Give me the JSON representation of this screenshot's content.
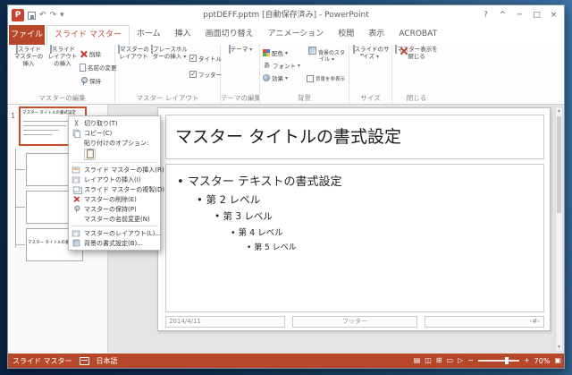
{
  "glyphs": {
    "dropdown": "▾",
    "check": "✓",
    "bullet": "•",
    "undo": "↶",
    "redo": "↷",
    "qat_arrow": "▾",
    "help": "?",
    "ribbon_options": "^",
    "minimize": "─",
    "maximize": "□",
    "close": "×",
    "app_letter": "P",
    "scroll_up": "▴",
    "scroll_down": "▾",
    "font_icon": "あ",
    "notes": "▤",
    "view_normal": "◫",
    "view_sorter": "⊞",
    "view_reading": "▭",
    "view_show": "▷",
    "zoom_out": "−",
    "zoom_in": "+",
    "fit": "▣"
  },
  "window": {
    "title": "pptDEFF.pptm [自動保存済み] - PowerPoint"
  },
  "ribbon": {
    "file_tab": "ファイル",
    "tabs": [
      {
        "label": "スライド マスター"
      },
      {
        "label": "ホーム"
      },
      {
        "label": "挿入"
      },
      {
        "label": "画面切り替え"
      },
      {
        "label": "アニメーション"
      },
      {
        "label": "校閲"
      },
      {
        "label": "表示"
      },
      {
        "label": "ACROBAT"
      }
    ],
    "groups": {
      "edit_master": {
        "label": "マスターの編集",
        "insert_master": "スライド マスターの挿入",
        "insert_layout": "スライド レイアウトの挿入",
        "delete": "削除",
        "rename": "名前の変更",
        "preserve": "保持"
      },
      "master_layout": {
        "label": "マスター レイアウト",
        "master_layout_btn": "マスターのレイアウト",
        "insert_placeholder": "プレースホルダーの挿入",
        "title_chk": "タイトル",
        "footer_chk": "フッター"
      },
      "edit_theme": {
        "label": "テーマの編集",
        "themes": "テーマ"
      },
      "background": {
        "label": "背景",
        "colors": "配色",
        "fonts": "フォント",
        "effects": "効果",
        "bg_styles": "背景のスタイル",
        "hide_bg": "背景を非表示"
      },
      "size": {
        "label": "サイズ",
        "slide_size": "スライドのサイズ"
      },
      "close_group": {
        "label": "閉じる",
        "close_master": "マスター表示を閉じる"
      }
    }
  },
  "panel": {
    "slide_number": "1",
    "master_thumb_title": "マスター タイトルの書式設定",
    "layout_thumb_title": "マスター タイトルの書式設定"
  },
  "context_menu": {
    "items": [
      {
        "label": "切り取り(T)"
      },
      {
        "label": "コピー(C)"
      },
      {
        "label": "貼り付けのオプション:"
      },
      {
        "label": "スライド マスターの挿入(R)"
      },
      {
        "label": "レイアウトの挿入(I)"
      },
      {
        "label": "スライド マスターの複製(D)"
      },
      {
        "label": "マスターの削除(E)"
      },
      {
        "label": "マスターの保持(P)"
      },
      {
        "label": "マスターの名前変更(N)"
      },
      {
        "label": "マスターのレイアウト(L)..."
      },
      {
        "label": "背景の書式設定(B)..."
      }
    ]
  },
  "slide": {
    "title": "マスター タイトルの書式設定",
    "bullets": [
      {
        "text": "マスター テキストの書式設定"
      },
      {
        "text": "第 2 レベル"
      },
      {
        "text": "第 3 レベル"
      },
      {
        "text": "第 4 レベル"
      },
      {
        "text": "第 5 レベル"
      }
    ],
    "date": "2014/4/11",
    "footer": "フッター",
    "slide_number": "‹#›"
  },
  "status": {
    "view": "スライド マスター",
    "lang": "日本語",
    "zoom": "70%"
  }
}
